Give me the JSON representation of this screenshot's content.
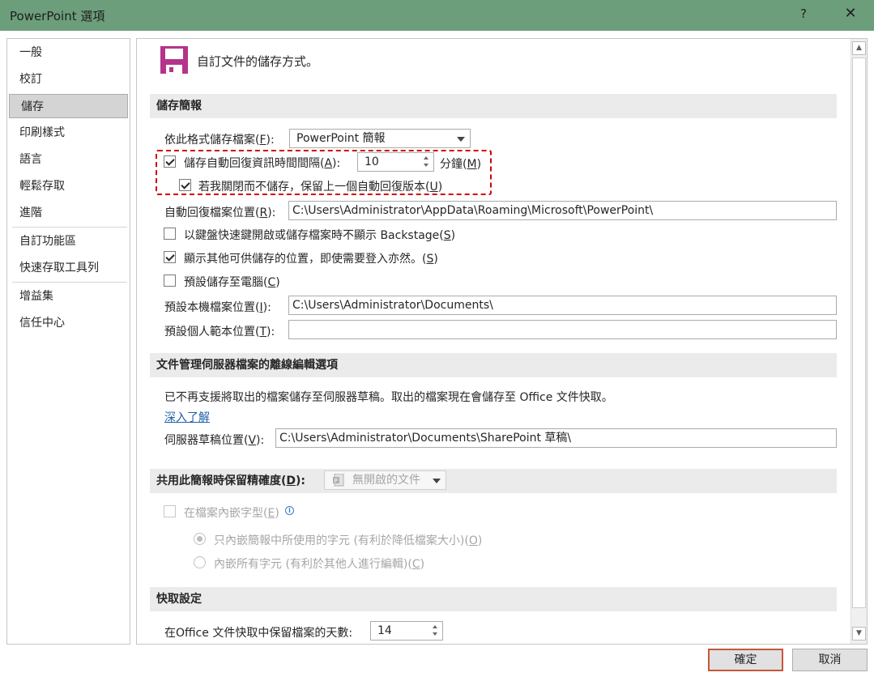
{
  "window": {
    "title": "PowerPoint 選項",
    "help_label": "?",
    "close_label": "✕"
  },
  "sidebar": {
    "items": [
      {
        "label": "一般"
      },
      {
        "label": "校訂"
      },
      {
        "label": "儲存"
      },
      {
        "label": "印刷樣式"
      },
      {
        "label": "語言"
      },
      {
        "label": "輕鬆存取"
      },
      {
        "label": "進階"
      },
      {
        "label": "自訂功能區"
      },
      {
        "label": "快速存取工具列"
      },
      {
        "label": "增益集"
      },
      {
        "label": "信任中心"
      }
    ],
    "active_index": 2
  },
  "header": {
    "title": "自訂文件的儲存方式。",
    "icon": "save-floppy-icon"
  },
  "save_section": {
    "heading": "儲存簡報",
    "format_label": "依此格式儲存檔案(",
    "format_key": "F",
    "format_tail": "):",
    "format_value": "PowerPoint 簡報",
    "autorecover_label": "儲存自動回復資訊時間間隔(",
    "autorecover_key": "A",
    "autorecover_tail": "):",
    "autorecover_checked": true,
    "autorecover_minutes": "10",
    "minutes_label": "分鐘(",
    "minutes_key": "M",
    "minutes_tail": ")",
    "keep_last_label": "若我關閉而不儲存，保留上一個自動回復版本(",
    "keep_last_key": "U",
    "keep_last_tail": ")",
    "keep_last_checked": true,
    "autorecover_location_label": "自動回復檔案位置(",
    "autorecover_location_key": "R",
    "autorecover_location_tail": "):",
    "autorecover_location_value": "C:\\Users\\Administrator\\AppData\\Roaming\\Microsoft\\PowerPoint\\",
    "no_backstage_label": "以鍵盤快速鍵開啟或儲存檔案時不顯示 Backstage(",
    "no_backstage_key": "S",
    "no_backstage_tail": ")",
    "no_backstage_checked": false,
    "show_locations_label": "顯示其他可供儲存的位置，即使需要登入亦然。(",
    "show_locations_key": "S",
    "show_locations_tail": ")",
    "show_locations_checked": true,
    "save_to_computer_label": "預設儲存至電腦(",
    "save_to_computer_key": "C",
    "save_to_computer_tail": ")",
    "save_to_computer_checked": false,
    "default_local_label": "預設本機檔案位置(",
    "default_local_key": "I",
    "default_local_tail": "):",
    "default_local_value": "C:\\Users\\Administrator\\Documents\\",
    "personal_templates_label": "預設個人範本位置(",
    "personal_templates_key": "T",
    "personal_templates_tail": "):",
    "personal_templates_value": ""
  },
  "offline_section": {
    "heading": "文件管理伺服器檔案的離線編輯選項",
    "notice": "已不再支援將取出的檔案儲存至伺服器草稿。取出的檔案現在會儲存至 Office 文件快取。",
    "learn_more": "深入了解",
    "drafts_label": "伺服器草稿位置(",
    "drafts_key": "V",
    "drafts_tail": "):",
    "drafts_value": "C:\\Users\\Administrator\\Documents\\SharePoint 草稿\\"
  },
  "fidelity_section": {
    "heading_prefix": "共用此簡報時保留精確度(",
    "heading_key": "D",
    "heading_tail": "):",
    "presentation_value": "無開啟的文件",
    "embed_fonts_label": "在檔案內嵌字型(",
    "embed_fonts_key": "E",
    "embed_fonts_tail": ")",
    "embed_used_label": "只內嵌簡報中所使用的字元 (有利於降低檔案大小)(",
    "embed_used_key": "O",
    "embed_used_tail": ")",
    "embed_all_label": "內嵌所有字元 (有利於其他人進行編輯)(",
    "embed_all_key": "C",
    "embed_all_tail": ")"
  },
  "cache_section": {
    "heading": "快取設定",
    "days_label": "在Office 文件快取中保留檔案的天數:",
    "days_value": "14"
  },
  "footer": {
    "ok_label": "確定",
    "cancel_label": "取消"
  },
  "colors": {
    "titlebar": "#6d9e7b",
    "save_icon": "#b5338a",
    "dashed_highlight": "#d20000",
    "primary_button_border": "#c5573a"
  }
}
